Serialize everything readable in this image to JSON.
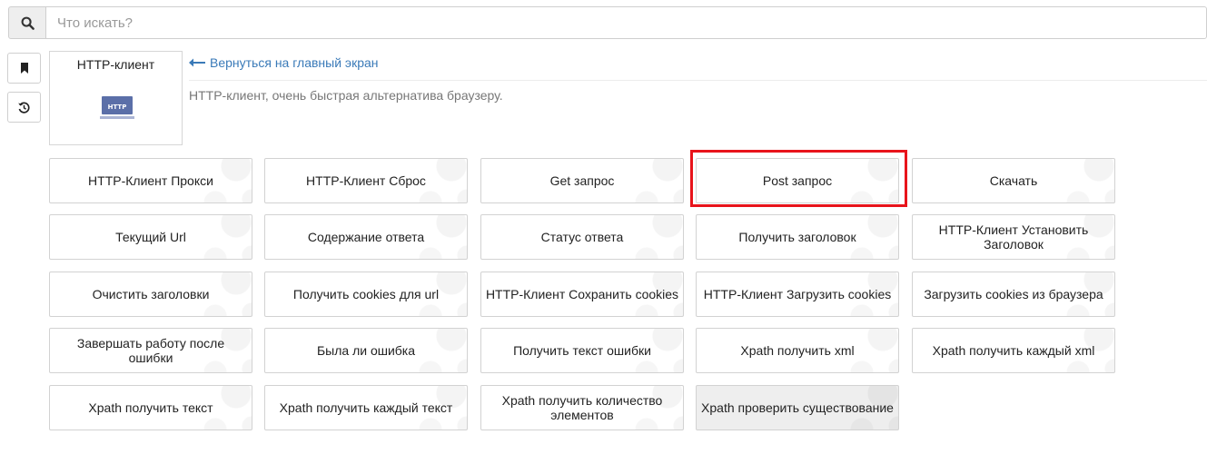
{
  "search": {
    "placeholder": "Что искать?",
    "icon": "search-icon"
  },
  "sidebar": {
    "icons": [
      "bookmark-icon",
      "history-icon"
    ]
  },
  "module": {
    "title": "HTTP-клиент",
    "icon_text": "HTTP",
    "back_link": "Вернуться на главный экран",
    "description": "HTTP-клиент, очень быстрая альтернатива браузеру."
  },
  "actions": [
    "HTTP-Клиент Прокси",
    "HTTP-Клиент Сброс",
    "Get запрос",
    "Post запрос",
    "Скачать",
    "Текущий Url",
    "Содержание ответа",
    "Статус ответа",
    "Получить заголовок",
    "HTTP-Клиент Установить Заголовок",
    "Очистить заголовки",
    "Получить cookies для url",
    "HTTP-Клиент Сохранить cookies",
    "HTTP-Клиент Загрузить cookies",
    "Загрузить cookies из браузера",
    "Завершать работу после ошибки",
    "Была ли ошибка",
    "Получить текст ошибки",
    "Xpath получить xml",
    "Xpath получить каждый xml",
    "Xpath получить текст",
    "Xpath получить каждый текст",
    "Xpath получить количество элементов",
    "Xpath проверить существование"
  ],
  "colors": {
    "link": "#3a7ab8",
    "highlight": "#e8141b",
    "icon_badge": "#5b6fa8"
  }
}
